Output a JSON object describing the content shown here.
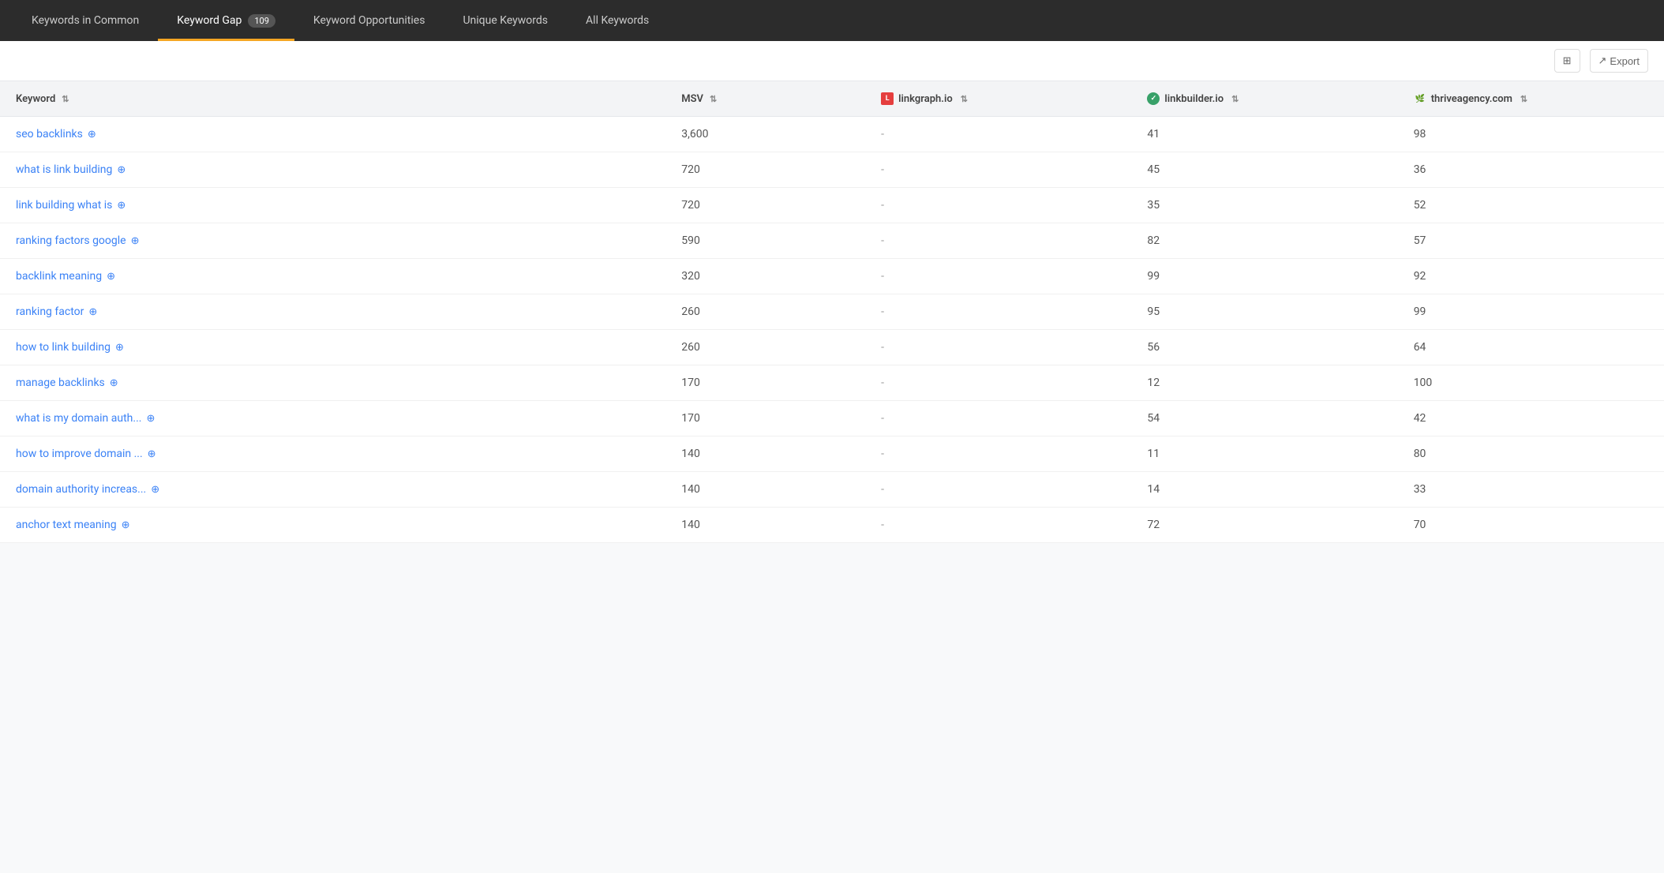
{
  "tabs": [
    {
      "id": "keywords-in-common",
      "label": "Keywords in Common",
      "badge": null,
      "active": false
    },
    {
      "id": "keyword-gap",
      "label": "Keyword Gap",
      "badge": "109",
      "active": true
    },
    {
      "id": "keyword-opportunities",
      "label": "Keyword Opportunities",
      "badge": null,
      "active": false
    },
    {
      "id": "unique-keywords",
      "label": "Unique Keywords",
      "badge": null,
      "active": false
    },
    {
      "id": "all-keywords",
      "label": "All Keywords",
      "badge": null,
      "active": false
    }
  ],
  "toolbar": {
    "columns_icon": "☰",
    "export_label": "Export"
  },
  "table": {
    "columns": [
      {
        "id": "keyword",
        "label": "Keyword"
      },
      {
        "id": "msv",
        "label": "MSV"
      },
      {
        "id": "linkgraph",
        "label": "linkgraph.io"
      },
      {
        "id": "linkbuilder",
        "label": "linkbuilder.io"
      },
      {
        "id": "thrive",
        "label": "thriveagency.com"
      }
    ],
    "rows": [
      {
        "keyword": "seo backlinks",
        "msv": "3,600",
        "linkgraph": "-",
        "linkbuilder": "41",
        "thrive": "98"
      },
      {
        "keyword": "what is link building",
        "msv": "720",
        "linkgraph": "-",
        "linkbuilder": "45",
        "thrive": "36"
      },
      {
        "keyword": "link building what is",
        "msv": "720",
        "linkgraph": "-",
        "linkbuilder": "35",
        "thrive": "52"
      },
      {
        "keyword": "ranking factors google",
        "msv": "590",
        "linkgraph": "-",
        "linkbuilder": "82",
        "thrive": "57"
      },
      {
        "keyword": "backlink meaning",
        "msv": "320",
        "linkgraph": "-",
        "linkbuilder": "99",
        "thrive": "92"
      },
      {
        "keyword": "ranking factor",
        "msv": "260",
        "linkgraph": "-",
        "linkbuilder": "95",
        "thrive": "99"
      },
      {
        "keyword": "how to link building",
        "msv": "260",
        "linkgraph": "-",
        "linkbuilder": "56",
        "thrive": "64"
      },
      {
        "keyword": "manage backlinks",
        "msv": "170",
        "linkgraph": "-",
        "linkbuilder": "12",
        "thrive": "100"
      },
      {
        "keyword": "what is my domain auth...",
        "msv": "170",
        "linkgraph": "-",
        "linkbuilder": "54",
        "thrive": "42"
      },
      {
        "keyword": "how to improve domain ...",
        "msv": "140",
        "linkgraph": "-",
        "linkbuilder": "11",
        "thrive": "80"
      },
      {
        "keyword": "domain authority increas...",
        "msv": "140",
        "linkgraph": "-",
        "linkbuilder": "14",
        "thrive": "33"
      },
      {
        "keyword": "anchor text meaning",
        "msv": "140",
        "linkgraph": "-",
        "linkbuilder": "72",
        "thrive": "70"
      }
    ]
  },
  "icons": {
    "sort": "⇅",
    "external_link": "⊕",
    "columns": "⊞",
    "export": "↗"
  },
  "colors": {
    "active_tab_underline": "#f5a623",
    "tab_bg": "#2c2c2c",
    "link_color": "#3b82f6"
  }
}
